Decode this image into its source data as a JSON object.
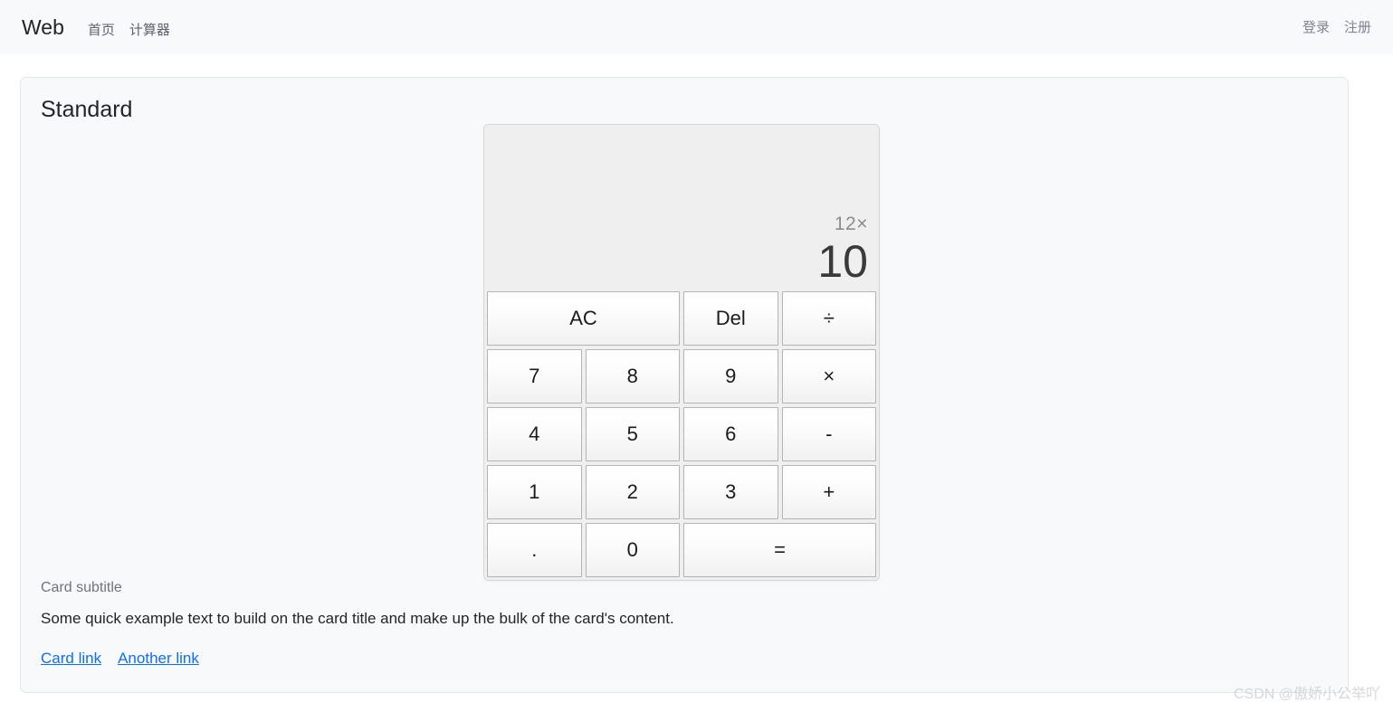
{
  "navbar": {
    "brand": "Web",
    "left_links": [
      {
        "label": "首页",
        "name": "nav-link-home"
      },
      {
        "label": "计算器",
        "name": "nav-link-calculator"
      }
    ],
    "right_links": [
      {
        "label": "登录",
        "name": "nav-link-login"
      },
      {
        "label": "注册",
        "name": "nav-link-register"
      }
    ]
  },
  "card": {
    "title": "Standard",
    "subtitle": "Card subtitle",
    "text": "Some quick example text to build on the card title and make up the bulk of the card's content.",
    "links": [
      {
        "label": "Card link"
      },
      {
        "label": "Another link"
      }
    ]
  },
  "calculator": {
    "display": {
      "history": "12×",
      "current": "10"
    },
    "keys": [
      {
        "label": "AC",
        "name": "key-all-clear",
        "span": 2
      },
      {
        "label": "Del",
        "name": "key-delete",
        "span": 1
      },
      {
        "label": "÷",
        "name": "key-divide",
        "span": 1
      },
      {
        "label": "7",
        "name": "key-7",
        "span": 1
      },
      {
        "label": "8",
        "name": "key-8",
        "span": 1
      },
      {
        "label": "9",
        "name": "key-9",
        "span": 1
      },
      {
        "label": "×",
        "name": "key-multiply",
        "span": 1
      },
      {
        "label": "4",
        "name": "key-4",
        "span": 1
      },
      {
        "label": "5",
        "name": "key-5",
        "span": 1
      },
      {
        "label": "6",
        "name": "key-6",
        "span": 1
      },
      {
        "label": "-",
        "name": "key-subtract",
        "span": 1
      },
      {
        "label": "1",
        "name": "key-1",
        "span": 1
      },
      {
        "label": "2",
        "name": "key-2",
        "span": 1
      },
      {
        "label": "3",
        "name": "key-3",
        "span": 1
      },
      {
        "label": "+",
        "name": "key-add",
        "span": 1
      },
      {
        "label": ".",
        "name": "key-decimal",
        "span": 1
      },
      {
        "label": "0",
        "name": "key-0",
        "span": 1
      },
      {
        "label": "=",
        "name": "key-equals",
        "span": 2
      }
    ]
  },
  "watermark": "CSDN @傲娇小公举吖",
  "colors": {
    "navbar_bg": "#f8f9fa",
    "card_bg": "#f8f9fa",
    "link": "#0d6efd",
    "muted": "#6c757d",
    "display_bg": "#efefef"
  }
}
